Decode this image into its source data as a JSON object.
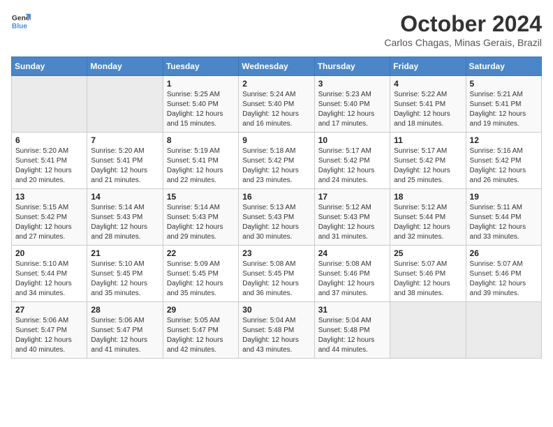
{
  "logo": {
    "line1": "General",
    "line2": "Blue"
  },
  "title": "October 2024",
  "subtitle": "Carlos Chagas, Minas Gerais, Brazil",
  "weekdays": [
    "Sunday",
    "Monday",
    "Tuesday",
    "Wednesday",
    "Thursday",
    "Friday",
    "Saturday"
  ],
  "weeks": [
    [
      {
        "day": "",
        "info": ""
      },
      {
        "day": "",
        "info": ""
      },
      {
        "day": "1",
        "info": "Sunrise: 5:25 AM\nSunset: 5:40 PM\nDaylight: 12 hours and 15 minutes."
      },
      {
        "day": "2",
        "info": "Sunrise: 5:24 AM\nSunset: 5:40 PM\nDaylight: 12 hours and 16 minutes."
      },
      {
        "day": "3",
        "info": "Sunrise: 5:23 AM\nSunset: 5:40 PM\nDaylight: 12 hours and 17 minutes."
      },
      {
        "day": "4",
        "info": "Sunrise: 5:22 AM\nSunset: 5:41 PM\nDaylight: 12 hours and 18 minutes."
      },
      {
        "day": "5",
        "info": "Sunrise: 5:21 AM\nSunset: 5:41 PM\nDaylight: 12 hours and 19 minutes."
      }
    ],
    [
      {
        "day": "6",
        "info": "Sunrise: 5:20 AM\nSunset: 5:41 PM\nDaylight: 12 hours and 20 minutes."
      },
      {
        "day": "7",
        "info": "Sunrise: 5:20 AM\nSunset: 5:41 PM\nDaylight: 12 hours and 21 minutes."
      },
      {
        "day": "8",
        "info": "Sunrise: 5:19 AM\nSunset: 5:41 PM\nDaylight: 12 hours and 22 minutes."
      },
      {
        "day": "9",
        "info": "Sunrise: 5:18 AM\nSunset: 5:42 PM\nDaylight: 12 hours and 23 minutes."
      },
      {
        "day": "10",
        "info": "Sunrise: 5:17 AM\nSunset: 5:42 PM\nDaylight: 12 hours and 24 minutes."
      },
      {
        "day": "11",
        "info": "Sunrise: 5:17 AM\nSunset: 5:42 PM\nDaylight: 12 hours and 25 minutes."
      },
      {
        "day": "12",
        "info": "Sunrise: 5:16 AM\nSunset: 5:42 PM\nDaylight: 12 hours and 26 minutes."
      }
    ],
    [
      {
        "day": "13",
        "info": "Sunrise: 5:15 AM\nSunset: 5:42 PM\nDaylight: 12 hours and 27 minutes."
      },
      {
        "day": "14",
        "info": "Sunrise: 5:14 AM\nSunset: 5:43 PM\nDaylight: 12 hours and 28 minutes."
      },
      {
        "day": "15",
        "info": "Sunrise: 5:14 AM\nSunset: 5:43 PM\nDaylight: 12 hours and 29 minutes."
      },
      {
        "day": "16",
        "info": "Sunrise: 5:13 AM\nSunset: 5:43 PM\nDaylight: 12 hours and 30 minutes."
      },
      {
        "day": "17",
        "info": "Sunrise: 5:12 AM\nSunset: 5:43 PM\nDaylight: 12 hours and 31 minutes."
      },
      {
        "day": "18",
        "info": "Sunrise: 5:12 AM\nSunset: 5:44 PM\nDaylight: 12 hours and 32 minutes."
      },
      {
        "day": "19",
        "info": "Sunrise: 5:11 AM\nSunset: 5:44 PM\nDaylight: 12 hours and 33 minutes."
      }
    ],
    [
      {
        "day": "20",
        "info": "Sunrise: 5:10 AM\nSunset: 5:44 PM\nDaylight: 12 hours and 34 minutes."
      },
      {
        "day": "21",
        "info": "Sunrise: 5:10 AM\nSunset: 5:45 PM\nDaylight: 12 hours and 35 minutes."
      },
      {
        "day": "22",
        "info": "Sunrise: 5:09 AM\nSunset: 5:45 PM\nDaylight: 12 hours and 35 minutes."
      },
      {
        "day": "23",
        "info": "Sunrise: 5:08 AM\nSunset: 5:45 PM\nDaylight: 12 hours and 36 minutes."
      },
      {
        "day": "24",
        "info": "Sunrise: 5:08 AM\nSunset: 5:46 PM\nDaylight: 12 hours and 37 minutes."
      },
      {
        "day": "25",
        "info": "Sunrise: 5:07 AM\nSunset: 5:46 PM\nDaylight: 12 hours and 38 minutes."
      },
      {
        "day": "26",
        "info": "Sunrise: 5:07 AM\nSunset: 5:46 PM\nDaylight: 12 hours and 39 minutes."
      }
    ],
    [
      {
        "day": "27",
        "info": "Sunrise: 5:06 AM\nSunset: 5:47 PM\nDaylight: 12 hours and 40 minutes."
      },
      {
        "day": "28",
        "info": "Sunrise: 5:06 AM\nSunset: 5:47 PM\nDaylight: 12 hours and 41 minutes."
      },
      {
        "day": "29",
        "info": "Sunrise: 5:05 AM\nSunset: 5:47 PM\nDaylight: 12 hours and 42 minutes."
      },
      {
        "day": "30",
        "info": "Sunrise: 5:04 AM\nSunset: 5:48 PM\nDaylight: 12 hours and 43 minutes."
      },
      {
        "day": "31",
        "info": "Sunrise: 5:04 AM\nSunset: 5:48 PM\nDaylight: 12 hours and 44 minutes."
      },
      {
        "day": "",
        "info": ""
      },
      {
        "day": "",
        "info": ""
      }
    ]
  ]
}
